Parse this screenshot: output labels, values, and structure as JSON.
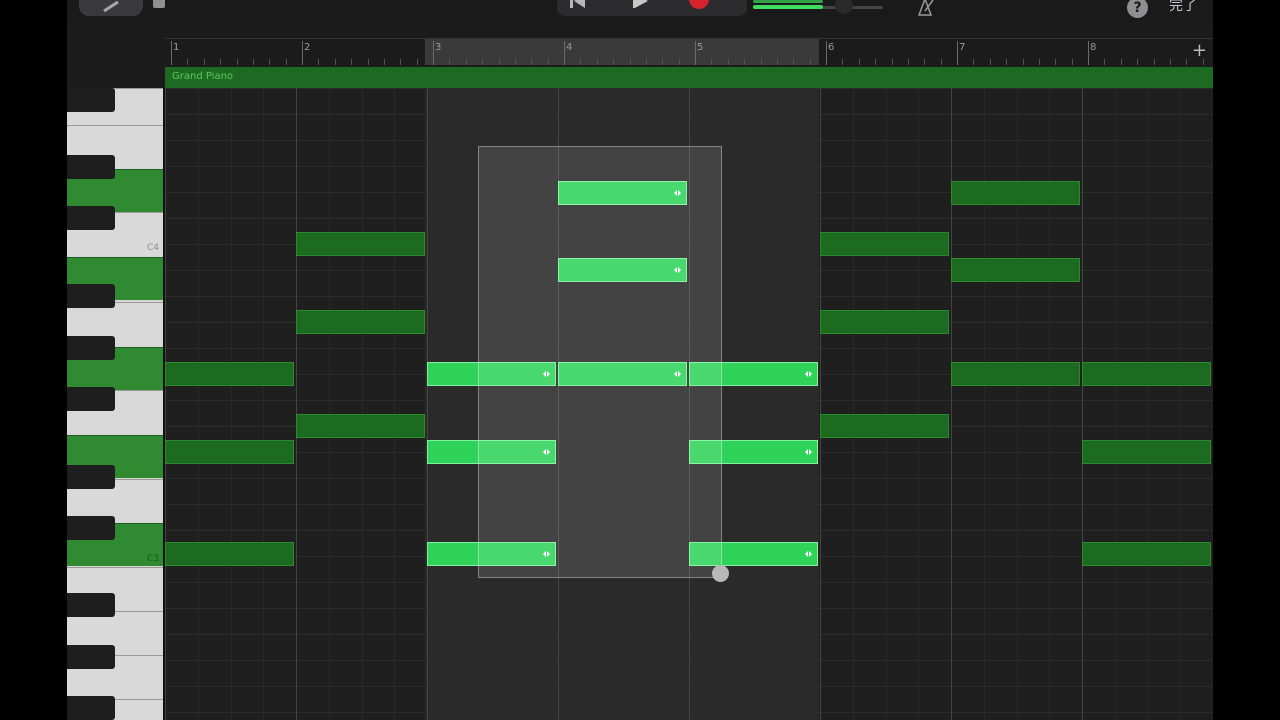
{
  "toolbar": {
    "tools": [
      "pencil-icon",
      "stop-icon"
    ],
    "transport": [
      "skip-back-icon",
      "play-icon",
      "record-icon"
    ],
    "record_color": "#d4232a",
    "help_label": "?",
    "done_label": "完了"
  },
  "ruler": {
    "bars": [
      "1",
      "2",
      "3",
      "4",
      "5",
      "6",
      "7",
      "8"
    ],
    "cycle_range": [
      "3",
      "5"
    ],
    "add_icon": "plus-icon"
  },
  "region": {
    "name": "Grand Piano",
    "color": "#2e8f30"
  },
  "keyboard": {
    "labels": [
      "C4",
      "C3"
    ]
  },
  "accent": {
    "note_selected": "#2fd35a",
    "note_unselected": "#1d6b21"
  }
}
